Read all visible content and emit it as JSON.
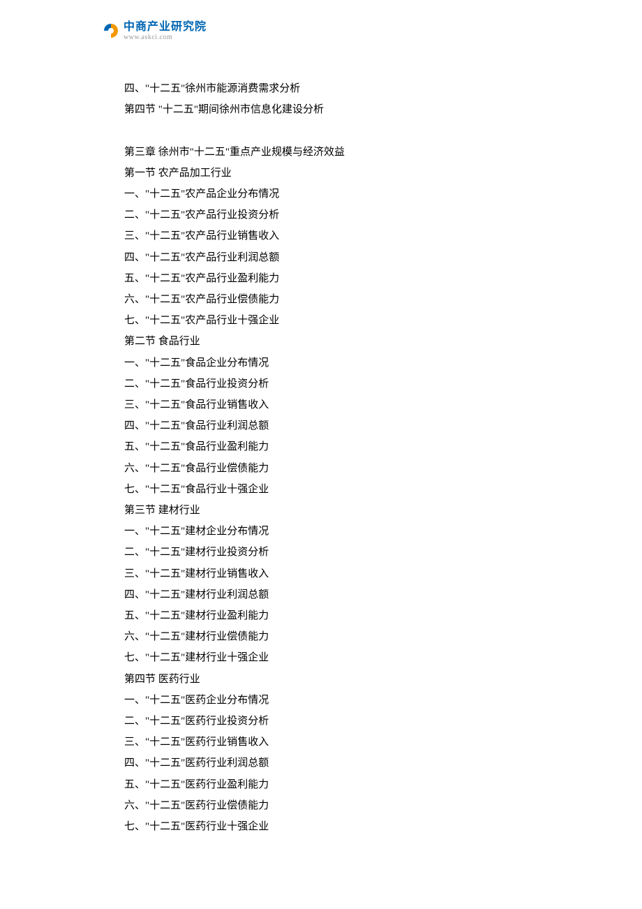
{
  "logo": {
    "chinese": "中商产业研究院",
    "url": "www.askci.com"
  },
  "lines": [
    "四、\"十二五\"徐州市能源消费需求分析",
    "第四节  \"十二五\"期间徐州市信息化建设分析",
    "",
    "第三章  徐州市\"十二五\"重点产业规模与经济效益",
    "第一节  农产品加工行业",
    "一、\"十二五\"农产品企业分布情况",
    "二、\"十二五\"农产品行业投资分析",
    "三、\"十二五\"农产品行业销售收入",
    "四、\"十二五\"农产品行业利润总额",
    "五、\"十二五\"农产品行业盈利能力",
    "六、\"十二五\"农产品行业偿债能力",
    "七、\"十二五\"农产品行业十强企业",
    "第二节  食品行业",
    "一、\"十二五\"食品企业分布情况",
    "二、\"十二五\"食品行业投资分析",
    "三、\"十二五\"食品行业销售收入",
    "四、\"十二五\"食品行业利润总额",
    "五、\"十二五\"食品行业盈利能力",
    "六、\"十二五\"食品行业偿债能力",
    "七、\"十二五\"食品行业十强企业",
    "第三节  建材行业",
    "一、\"十二五\"建材企业分布情况",
    "二、\"十二五\"建材行业投资分析",
    "三、\"十二五\"建材行业销售收入",
    "四、\"十二五\"建材行业利润总额",
    "五、\"十二五\"建材行业盈利能力",
    "六、\"十二五\"建材行业偿债能力",
    "七、\"十二五\"建材行业十强企业",
    "第四节  医药行业",
    "一、\"十二五\"医药企业分布情况",
    "二、\"十二五\"医药行业投资分析",
    "三、\"十二五\"医药行业销售收入",
    "四、\"十二五\"医药行业利润总额",
    "五、\"十二五\"医药行业盈利能力",
    "六、\"十二五\"医药行业偿债能力",
    "七、\"十二五\"医药行业十强企业"
  ]
}
